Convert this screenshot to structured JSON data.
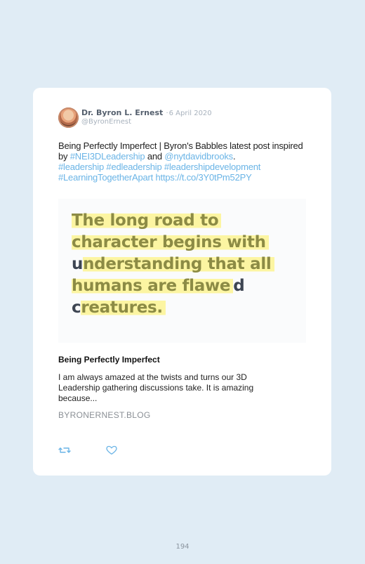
{
  "tweet": {
    "author_name": "Dr. Byron L. Ernest",
    "date": "6 April 2020",
    "handle": "@ByronErnest",
    "text_intro": "Being Perfectly Imperfect | Byron's Babbles latest post inspired by ",
    "mention_hashtag": "#NEI3DLeadership",
    "text_and": " and ",
    "mention_user": "@nytdavidbrooks",
    "text_period": ".",
    "hashtags_line": "#leadership #edleadership #leadershipdevelopment",
    "hashtag_last": "#LearningTogetherApart",
    "short_url": "https://t.co/3Y0tPm52PY"
  },
  "quote_image": {
    "line1": "The long road to",
    "line2": "character begins with",
    "line3_u": "u",
    "line3_rest": "nderstanding that all",
    "line4_hl": "humans are flawe",
    "line4_dark": "d",
    "line5_c": "c",
    "line5_rest": "reatures.",
    "highlight_color": "#fcf5a2",
    "text_color": "#8c8b45"
  },
  "link_card": {
    "title": "Being Perfectly Imperfect",
    "description": "I am always amazed at the twists and turns our 3D Leadership gathering discussions take. It is amazing because...",
    "domain": "BYRONERNEST.BLOG"
  },
  "actions": {
    "retweet_icon": "retweet-icon",
    "like_icon": "heart-icon"
  },
  "page": {
    "number": "194"
  }
}
